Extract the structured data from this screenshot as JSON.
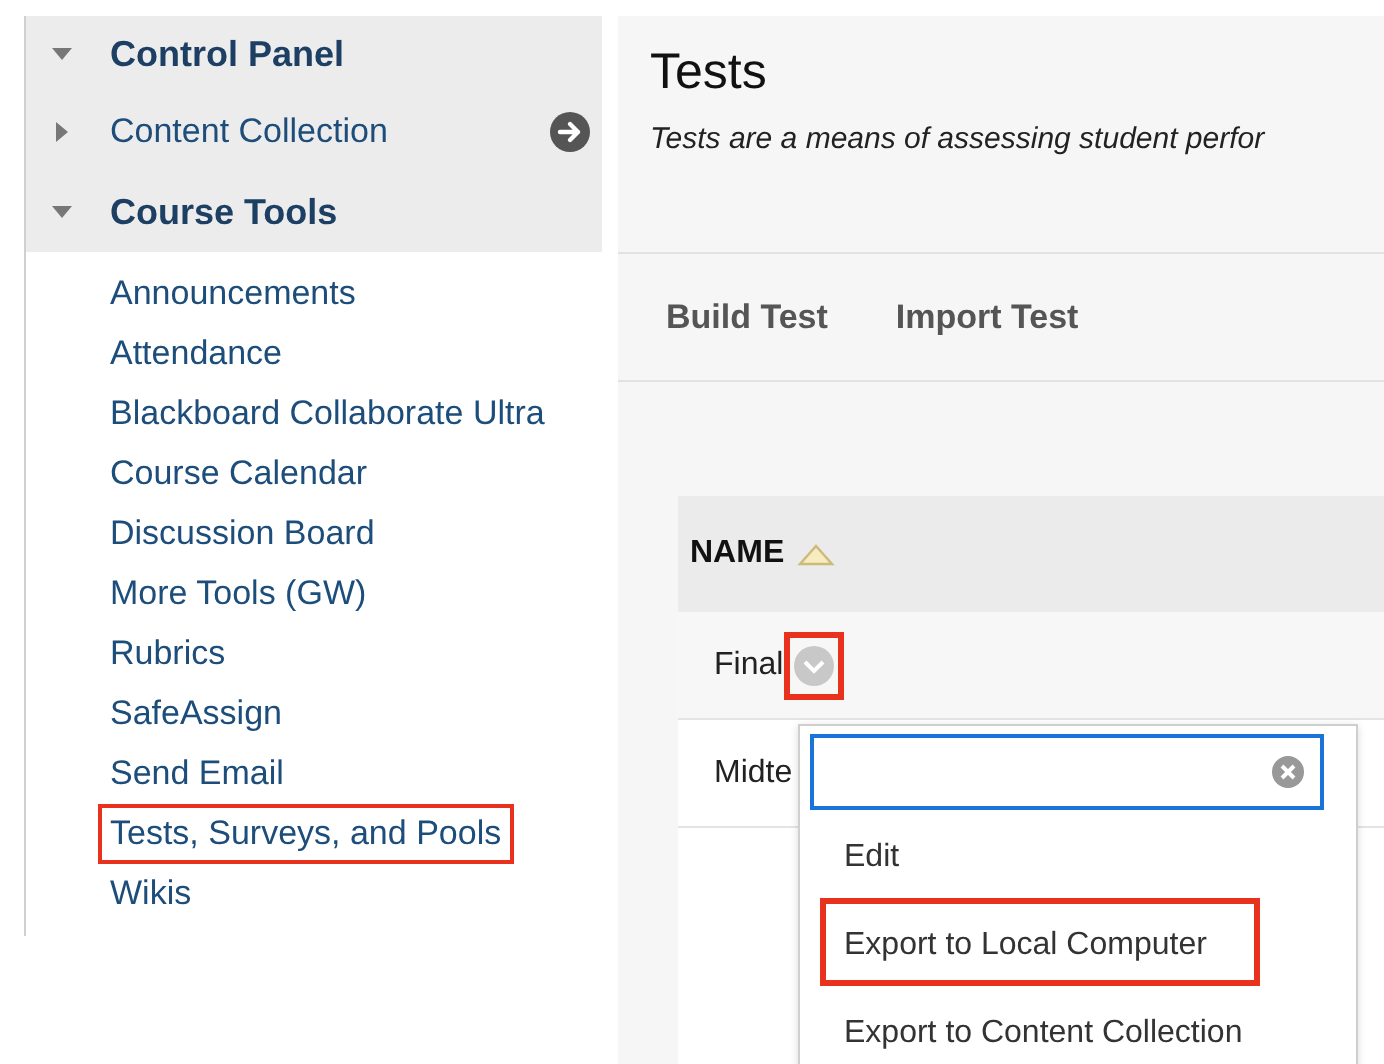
{
  "sidebar": {
    "sections": [
      {
        "label": "Control Panel",
        "kind": "header",
        "expanded": true
      },
      {
        "label": "Content Collection",
        "kind": "link",
        "expanded": false
      },
      {
        "label": "Course Tools",
        "kind": "header",
        "expanded": true,
        "children": [
          {
            "label": "Announcements",
            "highlighted": false
          },
          {
            "label": "Attendance",
            "highlighted": false
          },
          {
            "label": "Blackboard Collaborate Ultra",
            "highlighted": false
          },
          {
            "label": "Course Calendar",
            "highlighted": false
          },
          {
            "label": "Discussion Board",
            "highlighted": false
          },
          {
            "label": "More Tools (GW)",
            "highlighted": false
          },
          {
            "label": "Rubrics",
            "highlighted": false
          },
          {
            "label": "SafeAssign",
            "highlighted": false
          },
          {
            "label": "Send Email",
            "highlighted": false
          },
          {
            "label": "Tests, Surveys, and Pools",
            "highlighted": true
          },
          {
            "label": "Wikis",
            "highlighted": false
          }
        ]
      }
    ]
  },
  "page": {
    "title": "Tests",
    "description": "Tests are a means of assessing student perfor"
  },
  "actions": [
    "Build Test",
    "Import Test"
  ],
  "table": {
    "columns": [
      {
        "label": "NAME",
        "sorted": true
      }
    ],
    "rows": [
      {
        "name": "Final",
        "menu_highlighted": true
      },
      {
        "name": "Midte"
      }
    ]
  },
  "context_menu": {
    "items": [
      {
        "label": "Edit",
        "highlighted": false
      },
      {
        "label": "Export to Local Computer",
        "highlighted": true
      },
      {
        "label": "Export to Content Collection",
        "highlighted": false
      }
    ]
  }
}
